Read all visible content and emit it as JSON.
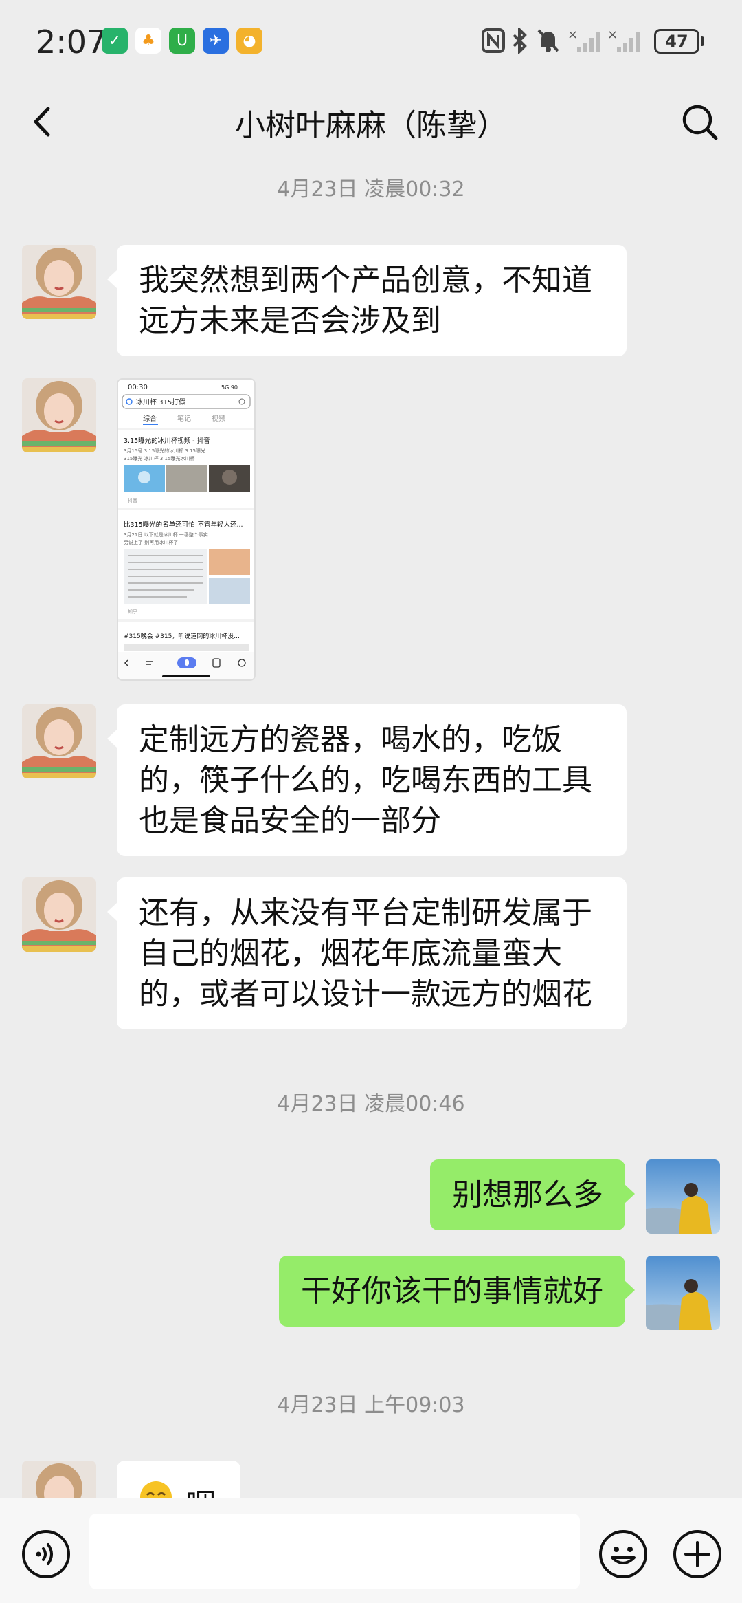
{
  "status_bar": {
    "time": "2:07",
    "battery": "47",
    "app_icons": [
      "app-1-icon",
      "app-2-icon",
      "app-3-icon",
      "app-4-icon",
      "app-5-icon"
    ]
  },
  "nav": {
    "title": "小树叶麻麻（陈挚）"
  },
  "messages": {
    "ts1": "4月23日 凌晨00:32",
    "m1": "我突然想到两个产品创意，不知道\n远方未来是否会涉及到",
    "m3": "定制远方的瓷器，喝水的，吃饭\n的，筷子什么的，吃喝东西的工具\n也是食品安全的一部分",
    "m4": "还有，从来没有平台定制研发属于\n自己的烟花，烟花年底流量蛮大\n的，或者可以设计一款远方的烟花",
    "ts2": "4月23日 凌晨00:46",
    "r1": "别想那么多",
    "r2": "干好你该干的事情就好",
    "ts3": "4月23日 上午09:03",
    "m5": "咽"
  },
  "shot": {
    "time": "00:30",
    "signal": "5G 90",
    "query": "冰川杯 315打假",
    "tabs": [
      "综合",
      "笔记",
      "视频"
    ],
    "r1_title": "3.15曝光的冰川杯视频 - 抖音",
    "r1_line1": "3月15号 3.15曝光的冰川杯 3.15曝光",
    "r1_line2": "315曝光 冰川杯 3·15曝光冰川杯",
    "r1_src": "抖音",
    "r2_title": "比315曝光的名单还可怕!不管年轻人还...",
    "r2_line1": "3月21日 以下就是冰川杯 一番整个事实",
    "r2_line2": "另说上了 别再用冰川杯了",
    "r2_src": "知乎",
    "r3_title": "#315晚会 #315，听说道网的冰川杯没..."
  },
  "colors": {
    "background": "#ededed",
    "bubble_left": "#ffffff",
    "bubble_right": "#95ec69",
    "timestamp": "#8d8d8d"
  }
}
